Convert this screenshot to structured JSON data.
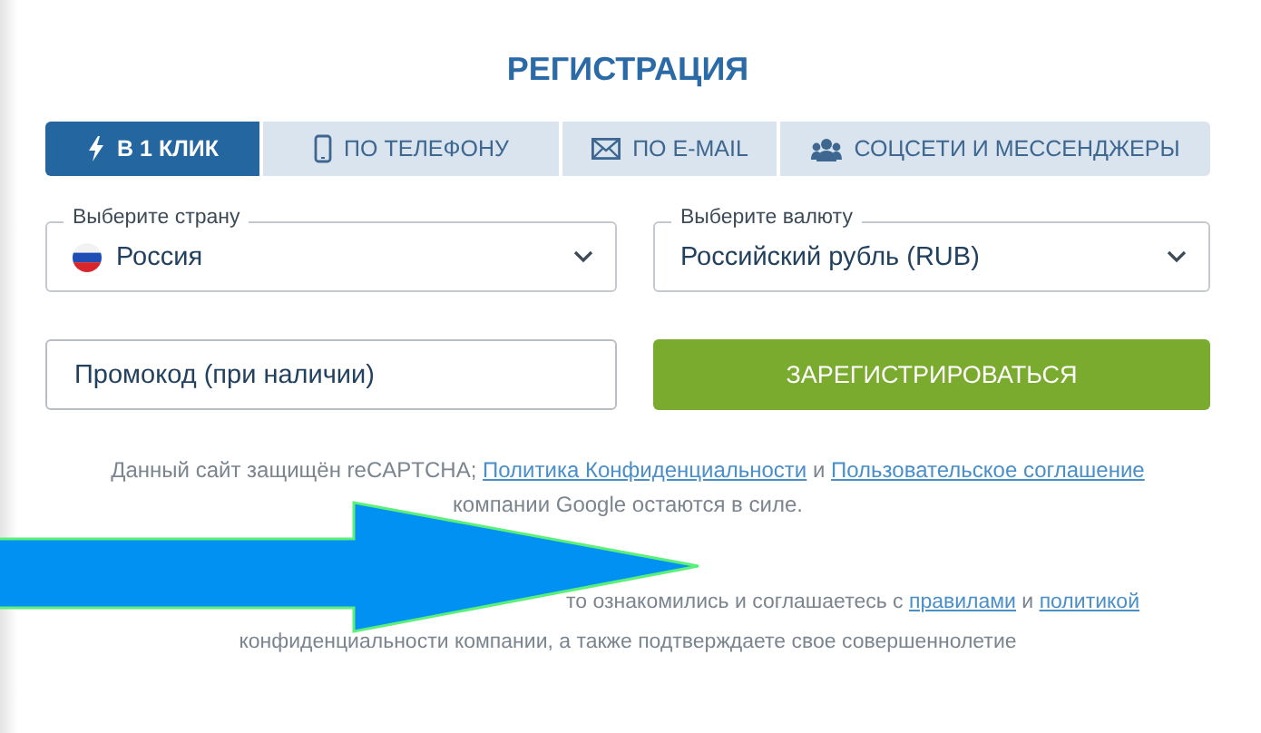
{
  "title": "РЕГИСТРАЦИЯ",
  "tabs": [
    {
      "label": "В 1 КЛИК",
      "selected": true
    },
    {
      "label": "ПО ТЕЛЕФОНУ",
      "selected": false
    },
    {
      "label": "ПО E-MAIL",
      "selected": false
    },
    {
      "label": "СОЦСЕТИ И МЕССЕНДЖЕРЫ",
      "selected": false
    }
  ],
  "country_select": {
    "label": "Выберите страну",
    "value": "Россия"
  },
  "currency_select": {
    "label": "Выберите валюту",
    "value": "Российский рубль (RUB)"
  },
  "promo_field": {
    "placeholder": "Промокод (при наличии)"
  },
  "register_button": "ЗАРЕГИСТРИРОВАТЬСЯ",
  "recaptcha_notice": {
    "before": "Данный сайт защищён reCAPTCHA;",
    "link1": "Политика Конфиденциальности",
    "middle": "и",
    "link2": "Пользовательское соглашение",
    "after": "компании Google остаются в силе."
  },
  "consent_notice": {
    "before": "то ознакомились и соглашаетесь с",
    "link1": "правилами",
    "middle": "и",
    "link2": "политикой",
    "after": "конфиденциальности компании, а также подтверждаете свое совершеннолетие"
  }
}
